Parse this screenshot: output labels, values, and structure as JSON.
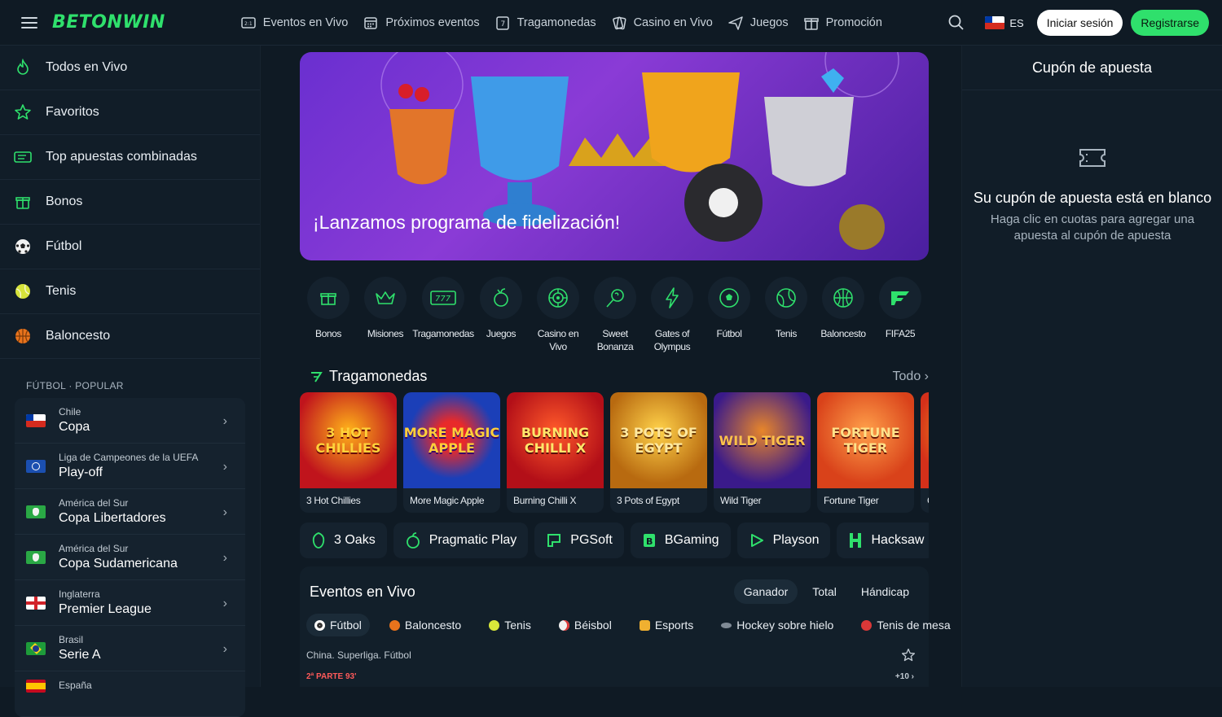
{
  "header": {
    "logo": "BETONWIN",
    "nav": [
      {
        "label": "Eventos en Vivo",
        "icon": "live-events-icon"
      },
      {
        "label": "Próximos eventos",
        "icon": "calendar-icon"
      },
      {
        "label": "Tragamonedas",
        "icon": "slots-icon"
      },
      {
        "label": "Casino en Vivo",
        "icon": "casino-cards-icon"
      },
      {
        "label": "Juegos",
        "icon": "plane-icon"
      },
      {
        "label": "Promoción",
        "icon": "gift-icon"
      }
    ],
    "lang": "ES",
    "login": "Iniciar sesión",
    "register": "Registrarse"
  },
  "sidebar": {
    "items": [
      {
        "label": "Todos en Vivo",
        "icon": "fire-icon"
      },
      {
        "label": "Favoritos",
        "icon": "star-icon"
      },
      {
        "label": "Top apuestas combinadas",
        "icon": "ticket-icon"
      },
      {
        "label": "Bonos",
        "icon": "gift-icon"
      },
      {
        "label": "Fútbol",
        "icon": "soccer-ball-icon"
      },
      {
        "label": "Tenis",
        "icon": "tennis-ball-icon"
      },
      {
        "label": "Baloncesto",
        "icon": "basketball-icon"
      }
    ],
    "section_title": "FÚTBOL · POPULAR",
    "leagues": [
      {
        "region": "Chile",
        "name": "Copa",
        "flag": "chile"
      },
      {
        "region": "Liga de Campeones de la UEFA",
        "name": "Play-off",
        "flag": "uefa"
      },
      {
        "region": "América del Sur",
        "name": "Copa Libertadores",
        "flag": "south-america"
      },
      {
        "region": "América del Sur",
        "name": "Copa Sudamericana",
        "flag": "south-america"
      },
      {
        "region": "Inglaterra",
        "name": "Premier League",
        "flag": "england"
      },
      {
        "region": "Brasil",
        "name": "Serie A",
        "flag": "brazil"
      },
      {
        "region": "España",
        "name": "",
        "flag": "spain"
      }
    ]
  },
  "main": {
    "banner_title": "¡Lanzamos programa de fidelización!",
    "categories": [
      {
        "label": "Bonos",
        "icon": "gift-icon"
      },
      {
        "label": "Misiones",
        "icon": "crown-icon"
      },
      {
        "label": "Tragamonedas",
        "icon": "slot-777-icon"
      },
      {
        "label": "Juegos",
        "icon": "fruit-icon"
      },
      {
        "label": "Casino en Vivo",
        "icon": "roulette-icon"
      },
      {
        "label": "Sweet Bonanza",
        "icon": "lollipop-icon"
      },
      {
        "label": "Gates of Olympus",
        "icon": "lightning-icon"
      },
      {
        "label": "Fútbol",
        "icon": "soccer-ball-icon"
      },
      {
        "label": "Tenis",
        "icon": "tennis-ball-icon"
      },
      {
        "label": "Baloncesto",
        "icon": "basketball-icon"
      },
      {
        "label": "FIFA25",
        "icon": "fifa-icon"
      }
    ],
    "slots_title": "Tragamonedas",
    "slots_all": "Todo",
    "games": [
      {
        "name": "3 Hot Chillies",
        "art": "3 HOT CHILLIES",
        "bg": "#c0141c",
        "fg": "#ffd23a"
      },
      {
        "name": "More Magic Apple",
        "art": "MORE MAGIC APPLE",
        "bg": "#1b3fb8",
        "fg": "#ffcf3a"
      },
      {
        "name": "Burning Chilli X",
        "art": "BURNING CHILLI X",
        "bg": "#b30f18",
        "fg": "#ffe66a"
      },
      {
        "name": "3 Pots of Egypt",
        "art": "3 POTS OF EGYPT",
        "bg": "#b86a10",
        "fg": "#ffe9a0"
      },
      {
        "name": "Wild Tiger",
        "art": "WILD TIGER",
        "bg": "#3a1a8a",
        "fg": "#ffc24a"
      },
      {
        "name": "Fortune Tiger",
        "art": "FORTUNE TIGER",
        "bg": "#d9421a",
        "fg": "#ffe28a"
      },
      {
        "name": "C",
        "art": "",
        "bg": "#d4301a",
        "fg": "#ffe28a"
      }
    ],
    "providers": [
      {
        "label": "3 Oaks",
        "icon": "oak-icon"
      },
      {
        "label": "Pragmatic Play",
        "icon": "pragmatic-icon"
      },
      {
        "label": "PGSoft",
        "icon": "pgsoft-icon"
      },
      {
        "label": "BGaming",
        "icon": "bgaming-icon"
      },
      {
        "label": "Playson",
        "icon": "playson-icon"
      },
      {
        "label": "Hacksaw",
        "icon": "hacksaw-icon"
      }
    ],
    "live": {
      "title": "Eventos en Vivo",
      "market_tabs": [
        "Ganador",
        "Total",
        "Hándicap"
      ],
      "sports": [
        {
          "label": "Fútbol",
          "color": "#ffffff"
        },
        {
          "label": "Baloncesto",
          "color": "#e8731c"
        },
        {
          "label": "Tenis",
          "color": "#d9e83a"
        },
        {
          "label": "Béisbol",
          "color": "#f0f0f0"
        },
        {
          "label": "Esports",
          "color": "#f0b030"
        },
        {
          "label": "Hockey sobre hielo",
          "color": "#7f8a95"
        },
        {
          "label": "Tenis de mesa",
          "color": "#d93838"
        }
      ],
      "league_line": "China. Superliga. Fútbol",
      "match_status": "2ª PARTE 93'",
      "more_markets": "+10 ›"
    }
  },
  "coupon": {
    "title": "Cupón de apuesta",
    "empty_title": "Su cupón de apuesta está en blanco",
    "empty_text": "Haga clic en cuotas para agregar una apuesta al cupón de apuesta"
  },
  "colors": {
    "accent": "#2fe06c",
    "bg": "#0f1a24",
    "panel": "#15222e"
  }
}
